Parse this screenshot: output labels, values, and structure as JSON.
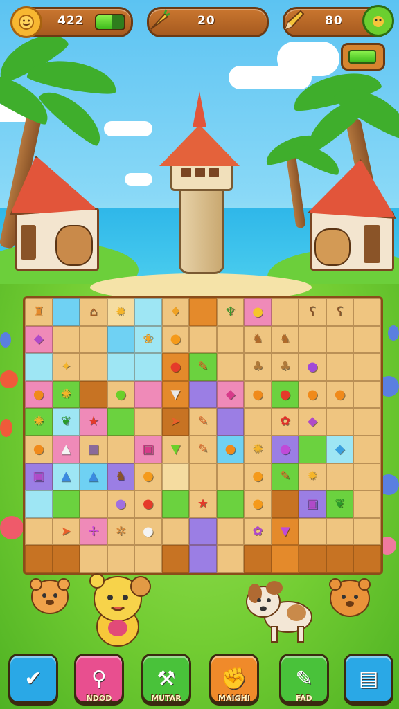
{
  "hud": {
    "coins": "422",
    "coins_icon": "coin-face-icon",
    "moves": "20",
    "moves_icon": "carrot-icon",
    "score": "80",
    "score_icon": "pencil-icon",
    "gauge_level": 0.55
  },
  "board": {
    "rows": [
      [
        "sandcastle",
        "empty",
        "house",
        "star-blob",
        "empty",
        "heart",
        "empty",
        "palm",
        "lemon",
        "empty",
        "bear",
        "bear",
        "empty"
      ],
      [
        "gem-block",
        "empty",
        "empty",
        "empty",
        "seashell",
        "orange",
        "empty",
        "empty",
        "giraffe",
        "giraffe",
        "empty",
        "empty",
        "empty"
      ],
      [
        "empty",
        "starfish",
        "empty",
        "empty",
        "empty",
        "apple",
        "pencil",
        "empty",
        "cat",
        "cat",
        "grape",
        "empty",
        "empty"
      ],
      [
        "drop",
        "sun",
        "empty",
        "ball",
        "empty",
        "turnip",
        "empty",
        "gem",
        "drop",
        "apple",
        "drop",
        "drop",
        "empty"
      ],
      [
        "sun",
        "leaf",
        "star",
        "empty",
        "empty",
        "carrot",
        "pencil",
        "empty",
        "empty",
        "ladybug",
        "gem-block",
        "empty",
        "empty"
      ],
      [
        "drop",
        "milk",
        "rock",
        "empty",
        "gift",
        "cup",
        "pencil",
        "drop",
        "sun",
        "berry",
        "empty",
        "crystal",
        "empty"
      ],
      [
        "box",
        "bottle",
        "bottle",
        "donkey",
        "orange",
        "empty",
        "empty",
        "empty",
        "orange",
        "pencil",
        "star-blob",
        "empty",
        "empty"
      ],
      [
        "empty",
        "empty",
        "empty",
        "plum",
        "apple",
        "empty",
        "star",
        "empty",
        "orange",
        "empty",
        "box",
        "leaf",
        "empty"
      ],
      [
        "empty",
        "carrot",
        "ghost",
        "cookie",
        "pearl",
        "empty",
        "empty",
        "empty",
        "flower",
        "bag",
        "empty",
        "empty",
        "empty"
      ]
    ]
  },
  "toolbar": {
    "buttons": [
      {
        "label": "",
        "icon": "check-icon",
        "color": "#2aa8e6"
      },
      {
        "label": "NDOD",
        "icon": "spray-icon",
        "color": "#e84f8f"
      },
      {
        "label": "MUTAR",
        "icon": "hammer-icon",
        "color": "#49c23a"
      },
      {
        "label": "MAIGHI",
        "icon": "fist-icon",
        "color": "#f08a2a"
      },
      {
        "label": "FAD",
        "icon": "paintbrush-icon",
        "color": "#49c23a"
      },
      {
        "label": "",
        "icon": "clipboard-icon",
        "color": "#2aa8e6"
      }
    ]
  }
}
